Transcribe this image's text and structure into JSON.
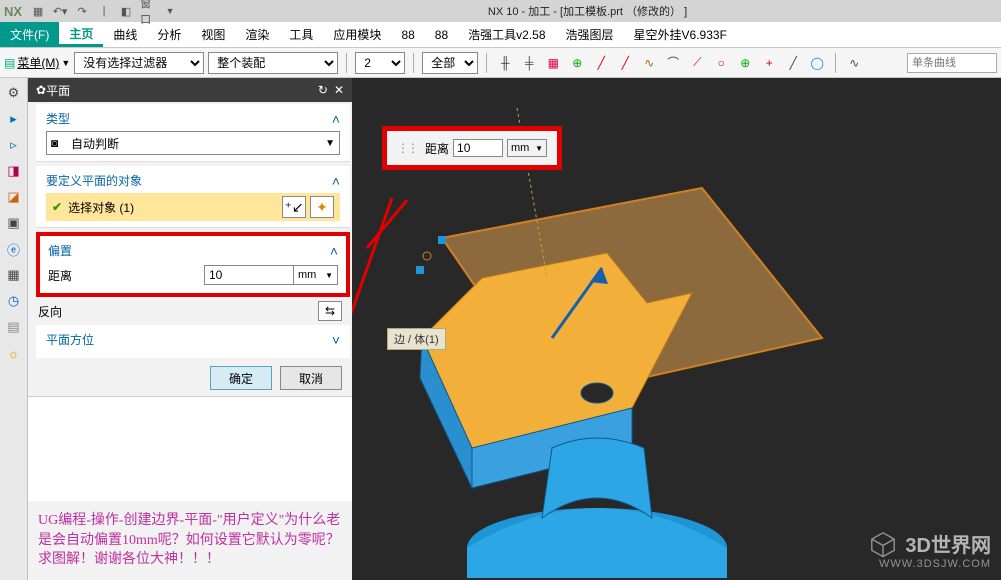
{
  "titlebar": {
    "app": "NX",
    "window_label": "窗口",
    "title": "NX 10 - 加工 - [加工模板.prt （修改的） ]"
  },
  "menubar": {
    "file": "文件(F)",
    "items": [
      "主页",
      "曲线",
      "分析",
      "视图",
      "渲染",
      "工具",
      "应用模块",
      "88",
      "88",
      "浩强工具v2.58",
      "浩强图层",
      "星空外挂V6.933F"
    ]
  },
  "toolbar": {
    "menu_btn": "菜单(M)",
    "filter": "没有选择过滤器",
    "assembly": "整个装配",
    "num": "2",
    "scope": "全部",
    "search_placeholder": "单条曲线"
  },
  "panel": {
    "title": "平面",
    "sections": {
      "type": {
        "label": "类型",
        "value": "自动判断"
      },
      "objects": {
        "label": "要定义平面的对象",
        "select_label": "选择对象 (1)"
      },
      "offset": {
        "label": "偏置",
        "dist_label": "距离",
        "dist_value": "10",
        "unit": "mm",
        "reverse": "反向"
      },
      "orient": {
        "label": "平面方位"
      }
    },
    "buttons": {
      "ok": "确定",
      "cancel": "取消"
    }
  },
  "float": {
    "label": "距离",
    "value": "10",
    "unit": "mm"
  },
  "edge_label": "边 / 体(1)",
  "annotation": "UG编程-操作-创建边界-平面-\"用户定义\"为什么老是会自动偏置10mm呢？如何设置它默认为零呢？求图解！谢谢各位大神！！！",
  "watermark": {
    "name": "3D世界网",
    "url": "WWW.3DSJW.COM"
  }
}
